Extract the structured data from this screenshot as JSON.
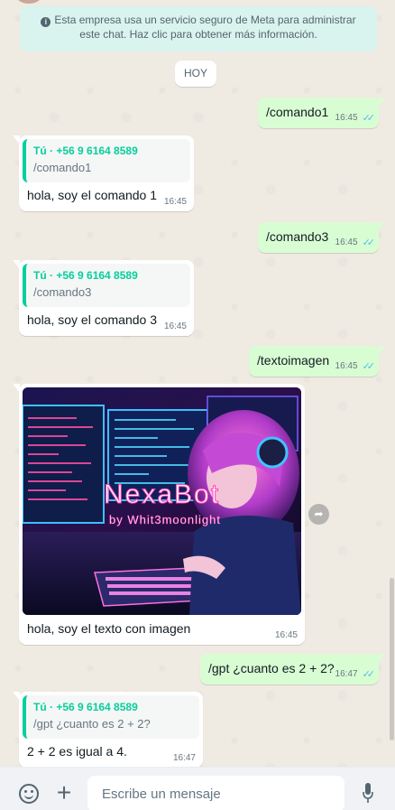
{
  "notice": {
    "text": "Esta empresa usa un servicio seguro de Meta para administrar este chat. Haz clic para obtener más información."
  },
  "day_chip": "HOY",
  "messages": [
    {
      "text": "/comando1",
      "time": "16:45"
    },
    {
      "quote_author": "Tú · +56 9 6164 8589",
      "quote_text": "/comando1",
      "text": "hola, soy el comando 1",
      "time": "16:45"
    },
    {
      "text": "/comando3",
      "time": "16:45"
    },
    {
      "quote_author": "Tú · +56 9 6164 8589",
      "quote_text": "/comando3",
      "text": "hola, soy el comando 3",
      "time": "16:45"
    },
    {
      "text": "/textoimagen",
      "time": "16:45"
    },
    {
      "image_title": "NexaBot",
      "image_subtitle": "by Whit3moonlight",
      "text": "hola, soy el texto con imagen",
      "time": "16:45"
    },
    {
      "text": "/gpt ¿cuanto es 2 + 2?",
      "time": "16:47"
    },
    {
      "quote_author": "Tú · +56 9 6164 8589",
      "quote_text": "/gpt ¿cuanto es 2 + 2?",
      "text": "2 + 2 es igual a 4.",
      "time": "16:47"
    }
  ],
  "composer": {
    "placeholder": "Escribe un mensaje"
  },
  "colors": {
    "outgoing_bubble": "#d9fdd3",
    "incoming_bubble": "#ffffff",
    "quote_accent": "#06cf9c",
    "read_ticks": "#53bdeb",
    "chat_background": "#efeae2"
  },
  "icons": [
    "info-icon",
    "read-ticks-icon",
    "forward-icon",
    "emoji-icon",
    "plus-icon",
    "microphone-icon"
  ]
}
